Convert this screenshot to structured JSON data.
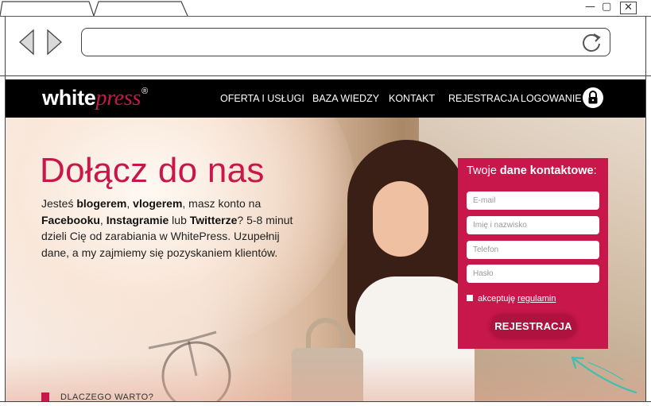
{
  "browser": {
    "window_controls": [
      "—",
      "▢",
      "✕"
    ]
  },
  "header": {
    "logo_part1": "white",
    "logo_part2": "press",
    "logo_reg": "®",
    "nav": [
      {
        "label": "OFERTA I USŁUGI"
      },
      {
        "label": "BAZA WIEDZY"
      },
      {
        "label": "KONTAKT"
      },
      {
        "label": "REJESTRACJA"
      },
      {
        "label": "LOGOWANIE"
      }
    ],
    "lock_icon": "lock-icon"
  },
  "hero": {
    "title": "Dołącz do nas",
    "text": {
      "p1": "Jesteś ",
      "b1": "blogerem",
      "p2": ", ",
      "b2": "vlogerem",
      "p3": ", masz konto na ",
      "b3": "Facebooku",
      "p4": ", ",
      "b4": "Instagramie",
      "p5": " lub ",
      "b5": "Twitterze",
      "p6": "? 5-8 minut dzieli Cię od zarabiania w WhitePress. Uzupełnij dane, a my zajmiemy się pozyskaniem klientów."
    }
  },
  "form": {
    "title_plain": "Twoje ",
    "title_bold": "dane kontaktowe",
    "title_colon": ":",
    "fields": {
      "email": {
        "placeholder": "E-mail",
        "value": ""
      },
      "name": {
        "placeholder": "Imię i nazwisko",
        "value": ""
      },
      "phone": {
        "placeholder": "Telefon",
        "value": ""
      },
      "password": {
        "placeholder": "Hasło",
        "value": ""
      }
    },
    "accept_label": "akceptuję ",
    "terms_link": "regulamin",
    "submit_label": "REJESTRACJA"
  },
  "footer_peek": {
    "label": "DLACZEGO WARTO?"
  },
  "colors": {
    "brand": "#c8174a",
    "header_bg": "#000000",
    "annotation_arrow": "#3fbfb0"
  }
}
